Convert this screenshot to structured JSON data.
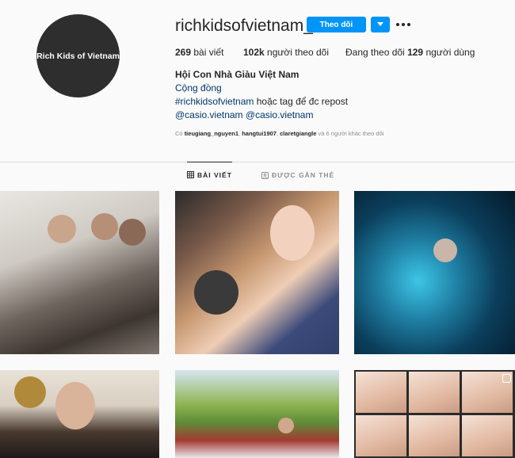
{
  "profile": {
    "avatar_text": "Rich Kids of Vietnam",
    "username": "richkidsofvietnam_",
    "follow_label": "Theo dõi"
  },
  "stats": {
    "posts_count": "269",
    "posts_label": "bài viết",
    "followers_count": "102k",
    "followers_label": "người theo dõi",
    "following_prefix": "Đang theo dõi",
    "following_count": "129",
    "following_suffix": "người dùng"
  },
  "bio": {
    "name": "Hội Con Nhà Giàu Việt Nam",
    "category": "Cộng đồng",
    "hashtag": "#richkidsofvietnam",
    "hashtag_text": "hoặc tag để đc repost",
    "mention1": "@casio.vietnam",
    "mention2": "@casio.vietnam"
  },
  "followed_by": {
    "prefix": "Có",
    "user1": "tieugiang_nguyen1",
    "user2": "hangtui1907",
    "user3": "claretgiangle",
    "suffix": "và 6 người khác theo dõi"
  },
  "tabs": {
    "posts": "BÀI VIẾT",
    "tagged": "ĐƯỢC GẮN THẺ"
  },
  "icons": {
    "dropdown": "chevron-down-icon",
    "more": "more-options-icon",
    "grid": "grid-icon",
    "tagged": "tag-person-icon",
    "carousel": "carousel-icon"
  },
  "colors": {
    "accent": "#0095f6",
    "link": "#00376b",
    "muted": "#8e8e8e",
    "background": "#fafafa"
  }
}
